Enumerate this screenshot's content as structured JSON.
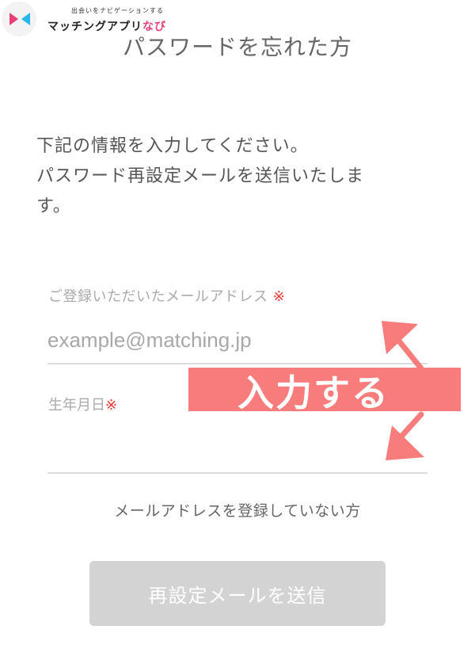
{
  "logo": {
    "tagline": "出会いをナビゲーションする",
    "name_main": "マッチングアプリ",
    "name_accent": "なび"
  },
  "page": {
    "title": "パスワードを忘れた方",
    "intro_line1": "下記の情報を入力してください。",
    "intro_line2": "パスワード再設定メールを送信いたしま",
    "intro_line3": "す。"
  },
  "form": {
    "email_label": "ご登録いただいたメールアドレス",
    "required_mark": "※",
    "email_placeholder": "example@matching.jp",
    "birthdate_label": "生年月日"
  },
  "link_no_email": "メールアドレスを登録していない方",
  "submit_label": "再設定メールを送信",
  "annotation": {
    "text": "入力する",
    "color": "#f87c7c"
  },
  "colors": {
    "accent_pink": "#e83e7a",
    "required_red": "#e53935",
    "button_disabled": "#d3d3d3"
  }
}
